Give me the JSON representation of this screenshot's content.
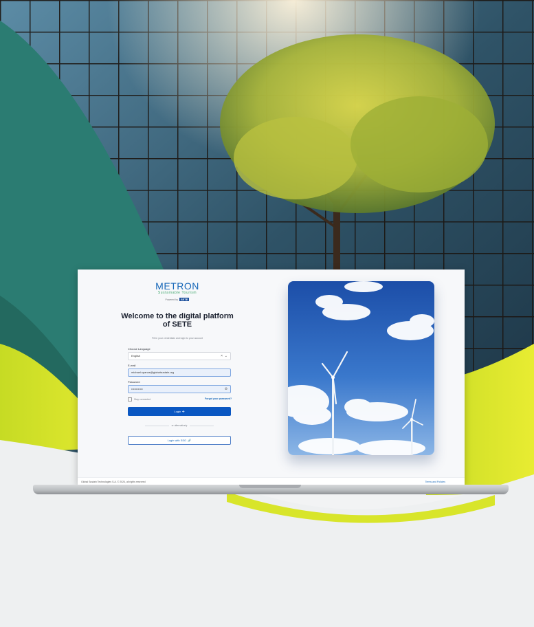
{
  "brand": {
    "logo": "METRON",
    "subtitle": "Sustainable Tourism",
    "powered_by": "Powered by",
    "powered_brand": "SETE"
  },
  "login": {
    "title": "Welcome to the digital platform of SETE",
    "instruction": "Fill in your credentials and login to your account",
    "language_label": "Choose Language",
    "language_value": "English",
    "email_label": "E-mail",
    "email_value": "michael.spanos@globalsustain.org",
    "password_label": "Password",
    "password_value": "••••••••••••",
    "stay_connected": "Stay connected",
    "forgot_password": "Forgot your password?",
    "login_button": "Login",
    "or_alt": "or alternatively",
    "sso_button": "Login with SSO"
  },
  "footer": {
    "copyright": "Global Sustain Technologies S.A. © 2024, all rights reserved",
    "terms": "Terms and Policies"
  },
  "colors": {
    "primary": "#0a57c2",
    "accent_green": "#3fa66b",
    "wave_lime": "#d7e32a",
    "wave_teal": "#2a7d73"
  },
  "icons": {
    "language_clear": "close-icon",
    "language_dropdown": "chevron-down-icon",
    "password_visibility": "eye-off-icon",
    "login": "login-arrow-icon",
    "sso": "link-icon"
  }
}
